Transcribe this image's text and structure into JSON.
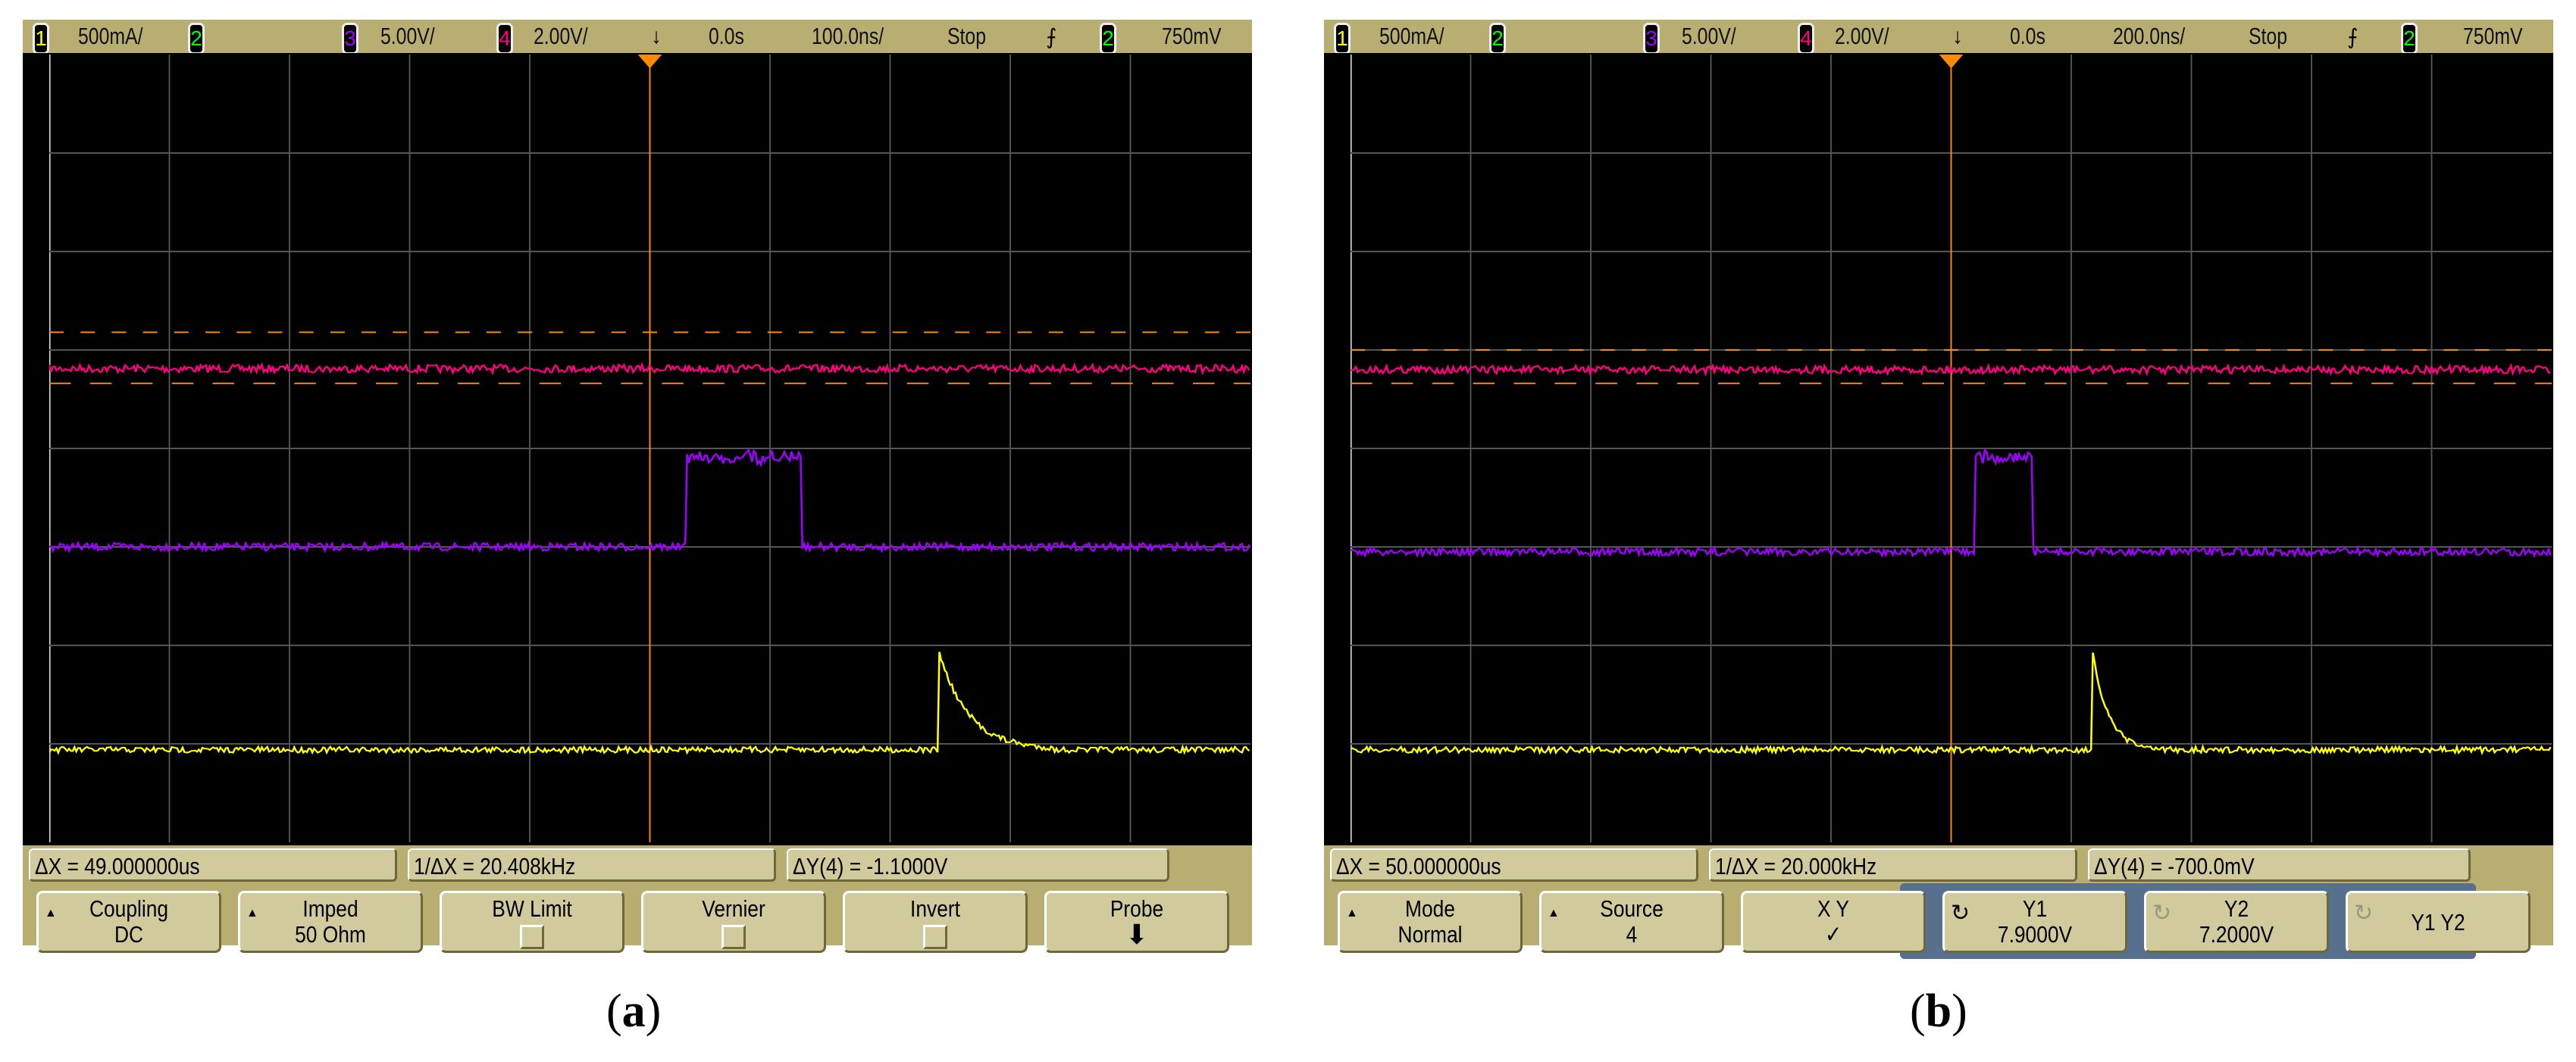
{
  "panels": [
    {
      "id": "a",
      "status": {
        "ch1": "1",
        "ch1_scale": "500mA/",
        "ch2": "2",
        "ch3": "3",
        "ch3_scale": "5.00V/",
        "ch4": "4",
        "ch4_scale": "2.00V/",
        "delay": "0.0s",
        "timebase": "100.0ns/",
        "run_state": "Stop",
        "trig_source": "2",
        "trig_level": "750mV"
      },
      "measurements": [
        "ΔX = 49.000000us",
        "1/ΔX = 20.408kHz",
        "ΔY(4) = -1.1000V"
      ],
      "buttons": [
        {
          "l1": "Coupling",
          "l2": "DC",
          "tri": true
        },
        {
          "l1": "Imped",
          "l2": "50 Ohm",
          "tri": true
        },
        {
          "l1": "BW Limit",
          "check": true
        },
        {
          "l1": "Vernier",
          "check": true
        },
        {
          "l1": "Invert",
          "check": true
        },
        {
          "l1": "Probe",
          "arrow": true
        }
      ],
      "caption_label": "a"
    },
    {
      "id": "b",
      "status": {
        "ch1": "1",
        "ch1_scale": "500mA/",
        "ch2": "2",
        "ch3": "3",
        "ch3_scale": "5.00V/",
        "ch4": "4",
        "ch4_scale": "2.00V/",
        "delay": "0.0s",
        "timebase": "200.0ns/",
        "run_state": "Stop",
        "trig_source": "2",
        "trig_level": "750mV"
      },
      "measurements": [
        "ΔX = 50.000000us",
        "1/ΔX = 20.000kHz",
        "ΔY(4) = -700.0mV"
      ],
      "buttons": [
        {
          "l1": "Mode",
          "l2": "Normal",
          "tri": true
        },
        {
          "l1": "Source",
          "l2": "4",
          "tri": true
        },
        {
          "l1": "X          Y",
          "l2": "✓"
        },
        {
          "l1": "Y1",
          "l2": "7.9000V",
          "knob": true
        },
        {
          "l1": "Y2",
          "l2": "7.2000V",
          "knob": true,
          "dim": true
        },
        {
          "l1": "Y1 Y2",
          "knob": true,
          "dim": true
        }
      ],
      "caption_label": "b"
    }
  ],
  "colors": {
    "ch1": "#ffff00",
    "ch2": "#00ff00",
    "ch3": "#a000ff",
    "ch4": "#ff0080",
    "cursor": "#ff8c00",
    "grid": "#555555",
    "bezel": "#b8ae72"
  },
  "chart_data": [
    {
      "type": "line",
      "panel": "a",
      "units": "divisions (10 x 8 grid, y from top)",
      "xlim": [
        0,
        10
      ],
      "ylim": [
        0,
        8
      ],
      "cursor_y": [
        2.82,
        3.34
      ],
      "series": [
        {
          "name": "ch4",
          "baseline": 3.19
        },
        {
          "name": "ch3",
          "baseline": 5.0,
          "pulse_start": 5.3,
          "pulse_end": 6.26,
          "pulse_level": 4.04
        },
        {
          "name": "ch1",
          "baseline": 7.06,
          "spike_at": 7.41,
          "spike_peak": 6.08,
          "decay_end": 8.34
        }
      ]
    },
    {
      "type": "line",
      "panel": "b",
      "units": "divisions (10 x 8 grid, y from top)",
      "xlim": [
        0,
        10
      ],
      "ylim": [
        0,
        8
      ],
      "cursor_y": [
        3.0,
        3.34
      ],
      "series": [
        {
          "name": "ch4",
          "baseline": 3.2
        },
        {
          "name": "ch3",
          "baseline": 5.05,
          "pulse_start": 5.2,
          "pulse_end": 5.68,
          "pulse_level": 4.04
        },
        {
          "name": "ch1",
          "baseline": 7.06,
          "spike_at": 6.18,
          "spike_peak": 6.08,
          "decay_end": 6.66
        }
      ]
    }
  ]
}
